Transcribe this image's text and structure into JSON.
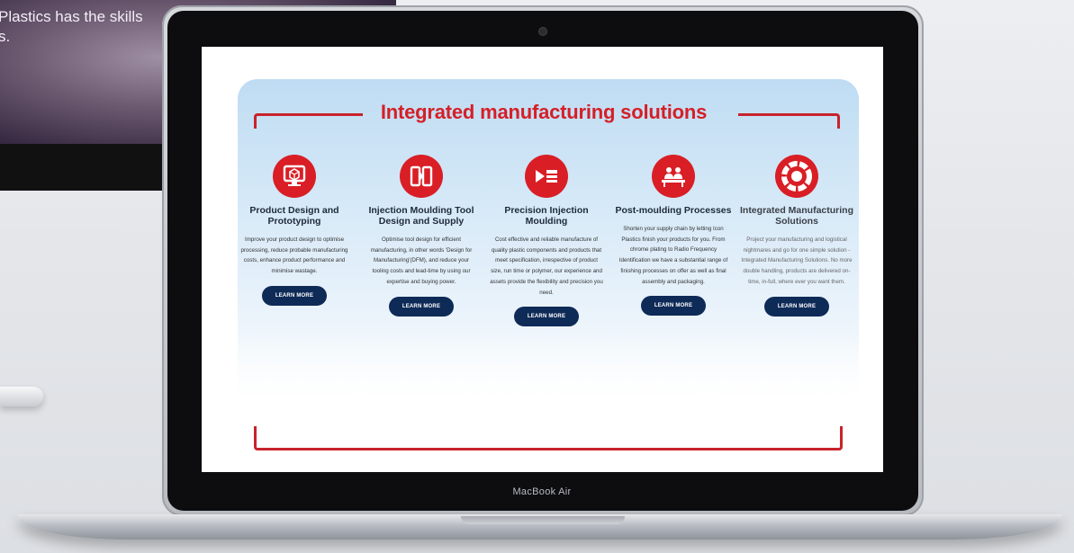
{
  "background_monitor": {
    "text": "Plastics has the skills\ns."
  },
  "laptop": {
    "brand": "MacBook Air"
  },
  "page": {
    "heading": "Integrated manufacturing solutions",
    "accent_color": "#d51f27",
    "button_color": "#0e2a57",
    "services": [
      {
        "icon": "monitor-cube-icon",
        "title": "Product Design and Prototyping",
        "description": "Improve your product design to optimise processing, reduce probable manufacturing costs, enhance product performance and minimise wastage.",
        "button": "LEARN MORE"
      },
      {
        "icon": "tool-mould-icon",
        "title": "Injection Moulding Tool Design and Supply",
        "description": "Optimise tool design for efficient manufacturing, in other words 'Design for Manufacturing'(DFM), and reduce your tooling costs and lead-time by using our expertise and buying power.",
        "button": "LEARN MORE"
      },
      {
        "icon": "injection-machine-icon",
        "title": "Precision Injection Moulding",
        "description": "Cost effective and reliable manufacture of quality plastic components and products that meet specification, irrespective of product size, run time or polymer, our experience and assets provide the flexibility and precision you need.",
        "button": "LEARN MORE"
      },
      {
        "icon": "assembly-workers-icon",
        "title": "Post-moulding Processes",
        "description": "Shorten your supply chain by letting Icon Plastics finish your products for you. From chrome plating to Radio Frequency Identification we have a substantial range of finishing processes on offer as well as final assembly and packaging.",
        "button": "LEARN MORE"
      },
      {
        "icon": "cycle-ring-icon",
        "title": "Integrated Manufacturing Solutions",
        "description": "Project your manufacturing and logistical nightmares and go for one simple solution - Integrated Manufacturing Solutions. No more double handling, products are delivered on-time, in-full, where ever you want them.",
        "button": "LEARN MORE"
      }
    ]
  }
}
